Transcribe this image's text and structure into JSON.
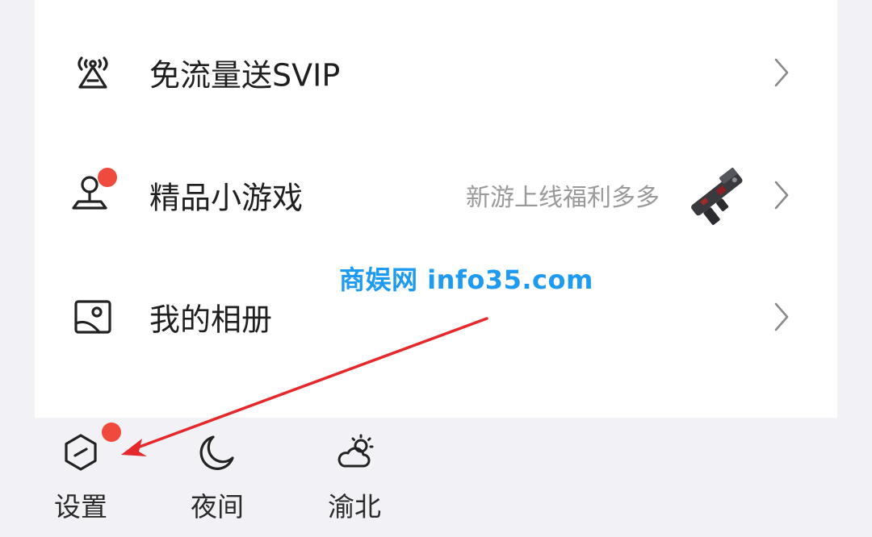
{
  "menu": {
    "items": [
      {
        "label": "免流量送SVIP",
        "icon": "signal-tower-icon"
      },
      {
        "label": "精品小游戏",
        "subtitle": "新游上线福利多多",
        "icon": "joystick-icon",
        "has_badge": true,
        "thumbnail": "game-gun-thumbnail"
      },
      {
        "label": "我的相册",
        "icon": "photo-album-icon"
      }
    ]
  },
  "dock": {
    "items": [
      {
        "label": "设置",
        "icon": "settings-hexagon-icon",
        "has_badge": true
      },
      {
        "label": "夜间",
        "icon": "moon-icon"
      },
      {
        "label": "渝北",
        "icon": "weather-cloud-sun-icon"
      }
    ]
  },
  "watermark": {
    "text": "商娱网 info35.com"
  },
  "colors": {
    "badge": "#f04a3e",
    "arrow": "#e5282b",
    "watermark": "#1e9bf0",
    "background": "#f2f2f6",
    "card": "#ffffff"
  }
}
